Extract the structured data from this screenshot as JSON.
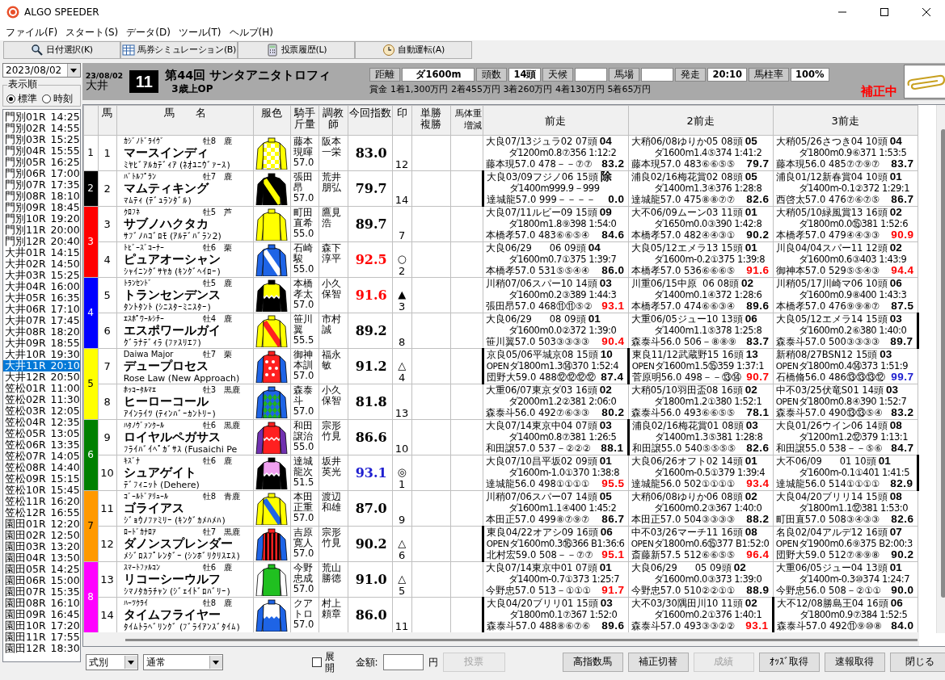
{
  "window": {
    "title": "ALGO SPEEDER"
  },
  "menu": [
    "ファイル(F)",
    "スタート(S)",
    "データ(D)",
    "ツール(T)",
    "ヘルプ(H)"
  ],
  "toolbar": [
    "日付選択(K)",
    "馬券シミュレーション(B)",
    "投票履歴(L)",
    "自動運転(A)"
  ],
  "date_picker": {
    "value": "2023/08/02"
  },
  "sort_order": {
    "label": "表示順",
    "options": [
      {
        "label": "標準",
        "selected": true
      },
      {
        "label": "時刻",
        "selected": false
      }
    ]
  },
  "races": [
    {
      "name": "門別01R",
      "time": "14:25",
      "selected": false
    },
    {
      "name": "門別02R",
      "time": "14:55",
      "selected": false
    },
    {
      "name": "門別03R",
      "time": "15:25",
      "selected": false
    },
    {
      "name": "門別04R",
      "time": "15:55",
      "selected": false
    },
    {
      "name": "門別05R",
      "time": "16:25",
      "selected": false
    },
    {
      "name": "門別06R",
      "time": "17:00",
      "selected": false
    },
    {
      "name": "門別07R",
      "time": "17:35",
      "selected": false
    },
    {
      "name": "門別08R",
      "time": "18:10",
      "selected": false
    },
    {
      "name": "門別09R",
      "time": "18:45",
      "selected": false
    },
    {
      "name": "門別10R",
      "time": "19:20",
      "selected": false
    },
    {
      "name": "門別11R",
      "time": "20:00",
      "selected": false
    },
    {
      "name": "門別12R",
      "time": "20:40",
      "selected": false
    },
    {
      "name": "大井01R",
      "time": "14:15",
      "selected": false
    },
    {
      "name": "大井02R",
      "time": "14:50",
      "selected": false
    },
    {
      "name": "大井03R",
      "time": "15:25",
      "selected": false
    },
    {
      "name": "大井04R",
      "time": "16:00",
      "selected": false
    },
    {
      "name": "大井05R",
      "time": "16:35",
      "selected": false
    },
    {
      "name": "大井06R",
      "time": "17:10",
      "selected": false
    },
    {
      "name": "大井07R",
      "time": "17:45",
      "selected": false
    },
    {
      "name": "大井08R",
      "time": "18:20",
      "selected": false
    },
    {
      "name": "大井09R",
      "time": "18:55",
      "selected": false
    },
    {
      "name": "大井10R",
      "time": "19:30",
      "selected": false
    },
    {
      "name": "大井11R",
      "time": "20:10",
      "selected": true
    },
    {
      "name": "大井12R",
      "time": "20:50",
      "selected": false
    },
    {
      "name": "笠松01R",
      "time": "11:00",
      "selected": false
    },
    {
      "name": "笠松02R",
      "time": "11:30",
      "selected": false
    },
    {
      "name": "笠松03R",
      "time": "12:05",
      "selected": false
    },
    {
      "name": "笠松04R",
      "time": "12:35",
      "selected": false
    },
    {
      "name": "笠松05R",
      "time": "13:05",
      "selected": false
    },
    {
      "name": "笠松06R",
      "time": "13:35",
      "selected": false
    },
    {
      "name": "笠松07R",
      "time": "14:05",
      "selected": false
    },
    {
      "name": "笠松08R",
      "time": "14:40",
      "selected": false
    },
    {
      "name": "笠松09R",
      "time": "15:15",
      "selected": false
    },
    {
      "name": "笠松10R",
      "time": "15:45",
      "selected": false
    },
    {
      "name": "笠松11R",
      "time": "16:20",
      "selected": false
    },
    {
      "name": "笠松12R",
      "time": "16:55",
      "selected": false
    },
    {
      "name": "園田01R",
      "time": "12:20",
      "selected": false
    },
    {
      "name": "園田02R",
      "time": "12:50",
      "selected": false
    },
    {
      "name": "園田03R",
      "time": "13:20",
      "selected": false
    },
    {
      "name": "園田04R",
      "time": "13:50",
      "selected": false
    },
    {
      "name": "園田05R",
      "time": "14:25",
      "selected": false
    },
    {
      "name": "園田06R",
      "time": "15:00",
      "selected": false
    },
    {
      "name": "園田07R",
      "time": "15:35",
      "selected": false
    },
    {
      "name": "園田08R",
      "time": "16:10",
      "selected": false
    },
    {
      "name": "園田09R",
      "time": "16:45",
      "selected": false
    },
    {
      "name": "園田10R",
      "time": "17:20",
      "selected": false
    },
    {
      "name": "園田11R",
      "time": "17:55",
      "selected": false
    },
    {
      "name": "園田12R",
      "time": "18:30",
      "selected": false
    }
  ],
  "race_header": {
    "date": "23/08/02",
    "venue": "大井",
    "number": "11",
    "title": "第44回 サンタアニタトロフィ",
    "class": "3歳上OP",
    "fields": [
      {
        "label": "距離",
        "value": "ダ1600m"
      },
      {
        "label": "頭数",
        "value": "14頭"
      },
      {
        "label": "天候"
      },
      {
        "label": "馬場"
      },
      {
        "label": "発走",
        "value": "20:10"
      },
      {
        "label": "馬柱率",
        "value": "100%"
      }
    ],
    "prize": "賞金 1着1,300万円 2着455万円 3着260万円 4着130万円 5着65万円",
    "status": "補正中"
  },
  "table": {
    "columns": [
      "馬",
      "馬　　名",
      "服色",
      "騎手斤量",
      "調教師",
      "今回指数",
      "印",
      "単勝複勝",
      "馬体重増減",
      "前走",
      "2前走",
      "3前走"
    ],
    "frames": [
      {
        "number": "1",
        "color": "#ffffff",
        "horses": [
          {
            "number": "1",
            "sire": "ｶｼﾞﾉﾄﾞﾗｲｳﾞ",
            "sex_age": "牡8",
            "coat": "鹿",
            "name": "マースインディ",
            "dam": "ﾐﾔﾋﾞｱﾙｶﾃﾞｨｱ (ﾈｵﾕﾆｳﾞｧｰｽ)",
            "jockey": "藤本現暉",
            "weight": "57.0",
            "trainer": "阪本一栄",
            "index": "83.0",
            "color": "#000000",
            "popularity": "12",
            "end_bar": false,
            "races": [
              {
                "line": "大良07/13ジュラ02 07頭",
                "finish": "04",
                "detail": "ダ1200m0.8⑦356 1:12:2",
                "jockey": "藤本現57.0 478－－⑦⑦",
                "index": "83.2",
                "color": "#000000",
                "bar": false
              },
              {
                "line": "大稍06/08ゆりか05 08頭",
                "finish": "05",
                "detail": "ダ1600m1.4⑤374 1:41:2",
                "jockey": "藤本現57.0 483⑥⑥⑤⑤",
                "index": "79.7",
                "color": "#000000",
                "bar": false
              },
              {
                "line": "大稍05/26さつき04 10頭",
                "finish": "04",
                "detail": "ダ1800m0.9⑥371 1:53:5",
                "jockey": "藤本現56.0 485⑦⑦⑨⑦",
                "index": "83.7",
                "color": "#000000",
                "bar": false
              }
            ]
          }
        ]
      },
      {
        "number": "2",
        "color": "#000000",
        "horses": [
          {
            "number": "2",
            "sire": "ﾊﾞﾄﾙﾌﾟﾗﾝ",
            "sex_age": "牡7",
            "coat": "鹿",
            "name": "マムティキング",
            "dam": "ﾏﾑﾃｨ (ﾃﾞｭﾗﾝﾀﾞﾙ)",
            "jockey": "張田昂",
            "weight": "57.0",
            "trainer": "荒井朋弘",
            "index": "79.7",
            "color": "#000000",
            "popularity": "14",
            "end_bar": false,
            "races": [
              {
                "line": "大良03/09フジノ06 15頭",
                "finish": "除",
                "detail": "ダ1400m999.9－999",
                "jockey": "達城龍57.0 999－－－－",
                "index": "0.0",
                "color": "#000000",
                "bar": true
              },
              {
                "line": "浦良02/16梅花賞02 08頭",
                "finish": "05",
                "detail": "ダ1400m1.3④376 1:28:8",
                "jockey": "達城龍57.0 475⑧⑧⑦⑦",
                "index": "82.6",
                "color": "#000000",
                "bar": false
              },
              {
                "line": "浦良01/12新春賞04 10頭",
                "finish": "01",
                "detail": "ダ1400m-0.1②372 1:29:1",
                "jockey": "西啓太57.0 476⑦⑥⑦⑤",
                "index": "86.7",
                "color": "#000000",
                "bar": false
              }
            ]
          }
        ]
      },
      {
        "number": "3",
        "color": "#ff0000",
        "horses": [
          {
            "number": "3",
            "sire": "ｸﾛﾌﾈ",
            "sex_age": "牡5",
            "coat": "芦",
            "name": "サブノハクタカ",
            "dam": "ｻﾌﾞﾉﾊｺﾞﾛﾓ (ｱﾙﾃﾞﾊﾞﾗﾝ2)",
            "jockey": "町田直希",
            "weight": "55.0",
            "trainer": "鷹見浩",
            "index": "89.7",
            "color": "#000000",
            "popularity": "7",
            "end_bar": false,
            "races": [
              {
                "line": "大良07/11ルビー09 15頭",
                "finish": "09",
                "detail": "ダ1800m1.8⑨398 1:54:0",
                "jockey": "本橋孝57.0 483⑥⑥⑤④",
                "index": "84.6",
                "color": "#000000",
                "bar": false
              },
              {
                "line": "大不06/09ムーン03 11頭",
                "finish": "01",
                "detail": "ダ1650m0.0③390 1:42:8",
                "jockey": "本橋孝57.0 482④④③①",
                "index": "90.2",
                "color": "#000000",
                "bar": false
              },
              {
                "line": "大稍05/10緑風賞13 16頭",
                "finish": "02",
                "detail": "ダ1800m0.0⑮381 1:52:6",
                "jockey": "本橋孝57.0 479④④③③",
                "index": "90.9",
                "color": "#ff0000",
                "bar": false
              }
            ]
          },
          {
            "number": "4",
            "sire": "ﾄﾋﾞｰｽﾞｺｰﾅｰ",
            "sex_age": "牡6",
            "coat": "栗",
            "name": "ピュアオーシャン",
            "dam": "ｼｬｲﾆﾝｸﾞｻﾔｶ (ｷﾝｸﾞﾍｲﾛｰ)",
            "jockey": "石崎駿",
            "weight": "55.0",
            "trainer": "森下淳平",
            "index": "92.5",
            "color": "#ff0000",
            "mark": "○",
            "popularity": "2",
            "end_bar": false,
            "races": [
              {
                "line": "大良06/29      06 09頭",
                "finish": "04",
                "detail": "ダ1600m0.7①375 1:39:7",
                "jockey": "本橋孝57.0 531⑤⑤④④",
                "index": "86.0",
                "color": "#000000",
                "bar": false
              },
              {
                "line": "大良05/12エメラ13 15頭",
                "finish": "01",
                "detail": "ダ1600m-0.2①375 1:39:8",
                "jockey": "本橋孝57.0 536⑥⑥⑥⑤",
                "index": "91.6",
                "color": "#ff0000",
                "bar": false
              },
              {
                "line": "川良04/04スパー11 12頭",
                "finish": "02",
                "detail": "ダ1600m0.6③403 1:43:9",
                "jockey": "御神本57.0 529⑤⑤④③",
                "index": "94.4",
                "color": "#ff0000",
                "bar": false
              }
            ]
          }
        ]
      },
      {
        "number": "4",
        "color": "#0000ff",
        "horses": [
          {
            "number": "5",
            "sire": "ﾄﾗﾝｾﾝﾄﾞ",
            "sex_age": "牡5",
            "coat": "鹿",
            "name": "トランセンデンス",
            "dam": "ﾀﾝﾄﾀﾝﾄ (ｼﾆｽﾀｰﾐﾆｽﾀｰ)",
            "jockey": "本橋孝太",
            "weight": "57.0",
            "trainer": "小久保智",
            "index": "91.6",
            "color": "#ff0000",
            "mark": "▲",
            "popularity": "3",
            "end_bar": false,
            "races": [
              {
                "line": "川稍07/06スパー10 14頭",
                "finish": "03",
                "detail": "ダ1600m0.2③389 1:44:3",
                "jockey": "張田昂57.0 468⑪⑪⑤②",
                "index": "93.1",
                "color": "#ff0000",
                "bar": false
              },
              {
                "line": "川重06/15中原  06 08頭",
                "finish": "02",
                "detail": "ダ1400m0.1④372 1:28:6",
                "jockey": "本橋孝57.0 474⑥⑥③④",
                "index": "89.6",
                "color": "#000000",
                "bar": false
              },
              {
                "line": "川稍05/17川崎マ06 10頭",
                "finish": "06",
                "detail": "ダ1600m0.9⑧400 1:43:3",
                "jockey": "本橋孝57.0 476⑨⑨⑧⑦",
                "index": "87.5",
                "color": "#000000",
                "bar": false
              }
            ]
          },
          {
            "number": "6",
            "sire": "ｴｽﾎﾟﾜｰﾙｼﾁｰ",
            "sex_age": "牡4",
            "coat": "鹿",
            "name": "エスポワールガイ",
            "dam": "ｸﾞﾗﾅﾃﾞｨﾗ (ﾌｧｽﾘｴﾌ)",
            "jockey": "笹川翼",
            "weight": "55.5",
            "trainer": "市村誠",
            "index": "89.2",
            "color": "#000000",
            "popularity": "8",
            "end_bar": true,
            "races": [
              {
                "line": "大良06/29      08 09頭",
                "finish": "01",
                "detail": "ダ1600m0.0②372 1:39:0",
                "jockey": "笹川翼57.0 503③③③③",
                "index": "90.4",
                "color": "#ff0000",
                "bar": false
              },
              {
                "line": "大重06/05ジュー10 13頭",
                "finish": "06",
                "detail": "ダ1400m1.1⑤378 1:25:8",
                "jockey": "森泰斗56.0 506－⑧⑧⑨",
                "index": "83.7",
                "color": "#000000",
                "bar": false
              },
              {
                "line": "大良05/12エメラ14 15頭",
                "finish": "03",
                "detail": "ダ1600m0.2⑥380 1:40:0",
                "jockey": "森泰斗57.0 500③③③③",
                "index": "89.7",
                "color": "#000000",
                "bar": false
              }
            ]
          }
        ]
      },
      {
        "number": "5",
        "color": "#ffff00",
        "horses": [
          {
            "number": "7",
            "sire": "Daiwa Major",
            "sex_age": "牡7",
            "coat": "栗",
            "name": "デュープロセス",
            "dam": "Rose Law (New Approach)",
            "jockey": "御神本訓",
            "weight": "57.0",
            "trainer": "福永敏",
            "index": "91.2",
            "color": "#000000",
            "mark": "△",
            "popularity": "4",
            "end_bar": false,
            "races": [
              {
                "line": "京良05/06平城京08 15頭",
                "finish": "10",
                "class": "OPEN",
                "detail": "ダ1800m1.3⑭370 1:52:4",
                "jockey": "団野大59.0 488⑫⑫⑫⑫",
                "index": "87.4",
                "color": "#000000",
                "bar": true
              },
              {
                "line": "東良11/12武蔵野15 16頭",
                "finish": "13",
                "class": "OPEN",
                "detail": "ダ1600m1.5⑮359 1:37:1",
                "jockey": "菅原明56.0 498－－⑬⑭",
                "index": "90.7",
                "color": "#ff0000",
                "bar": true
              },
              {
                "line": "新稍08/27BSN12 15頭",
                "finish": "03",
                "class": "OPEN",
                "detail": "ダ1800m0.4⑭373 1:51:9",
                "jockey": "石橋脩56.0 486⑬⑬⑬⑫",
                "index": "99.7",
                "color": "#2020d0",
                "bar": false
              }
            ]
          },
          {
            "number": "8",
            "sire": "ﾎｯｺｰﾀﾙﾏｴ",
            "sex_age": "牡3",
            "coat": "黒鹿",
            "name": "ヒーローコール",
            "dam": "ｱｲﾝﾗｲﾂ (ﾃｨﾝﾊﾞｰｶﾝﾄﾘｰ)",
            "jockey": "森泰斗",
            "weight": "57.0",
            "trainer": "小久保智",
            "index": "81.8",
            "color": "#000000",
            "popularity": "13",
            "end_bar": false,
            "races": [
              {
                "line": "大重06/07東京ダ03 16頭",
                "finish": "02",
                "detail": "ダ2000m1.2②381 2:06:0",
                "jockey": "森泰斗56.0 492⑦⑥③③",
                "index": "80.2",
                "color": "#000000",
                "bar": false
              },
              {
                "line": "大稍05/10羽田盃08 16頭",
                "finish": "02",
                "detail": "ダ1800m1.2①380 1:52:1",
                "jockey": "森泰斗56.0 493⑥⑥⑤⑤",
                "index": "78.1",
                "color": "#000000",
                "bar": false
              },
              {
                "line": "中不03/25伏竜S01 14頭",
                "finish": "03",
                "class": "OPEN",
                "detail": "ダ1800m0.8④390 1:52:7",
                "jockey": "森泰斗57.0 490⑬⑬⑤④",
                "index": "83.2",
                "color": "#000000",
                "bar": false
              }
            ]
          }
        ]
      },
      {
        "number": "6",
        "color": "#008000",
        "horses": [
          {
            "number": "9",
            "sire": "ﾊﾀﾉｳﾞｧﾝｸｰﾙ",
            "sex_age": "牡6",
            "coat": "黒鹿",
            "name": "ロイヤルペガサス",
            "dam": "ﾌﾗｲﾊﾞｲﾍﾟｶﾞｻｽ (Fusaichi Pe",
            "jockey": "和田譲治",
            "weight": "55.0",
            "trainer": "宗形竹見",
            "index": "86.6",
            "color": "#000000",
            "popularity": "10",
            "end_bar": false,
            "races": [
              {
                "line": "大良07/14東京中04 07頭",
                "finish": "03",
                "detail": "ダ1400m0.8⑦381 1:26:5",
                "jockey": "和田譲57.0 537－②②②",
                "index": "88.1",
                "color": "#000000",
                "bar": false
              },
              {
                "line": "浦良02/16梅花賞01 08頭",
                "finish": "03",
                "detail": "ダ1400m1.3⑤381 1:28:8",
                "jockey": "和田譲55.0 540⑤⑤⑤⑤",
                "index": "82.6",
                "color": "#000000",
                "bar": true
              },
              {
                "line": "大良01/26ウイン06 14頭",
                "finish": "08",
                "detail": "ダ1200m1.2⑫379 1:13:1",
                "jockey": "和田譲55.0 538－－⑤⑥",
                "index": "84.7",
                "color": "#000000",
                "bar": false
              }
            ]
          },
          {
            "number": "10",
            "sire": "ｷｽﾞﾅ",
            "sex_age": "牡6",
            "coat": "鹿",
            "name": "シュアゲイト",
            "dam": "ﾃﾞﾌｨﾆｯﾄ (Dehere)",
            "jockey": "達城龍次",
            "weight": "51.5",
            "trainer": "坂井英光",
            "index": "93.1",
            "color": "#2020d0",
            "mark": "◎",
            "popularity": "1",
            "end_bar": true,
            "races": [
              {
                "line": "大良07/10昌平坂02 09頭",
                "finish": "01",
                "detail": "ダ1600m-1.0①370 1:38:8",
                "jockey": "達城龍56.0 498①①①①",
                "index": "95.5",
                "color": "#ff0000",
                "bar": false
              },
              {
                "line": "大良06/26オフト02 14頭",
                "finish": "01",
                "detail": "ダ1600m-0.5①379 1:39:4",
                "jockey": "達城龍56.0 502①①①①",
                "index": "93.4",
                "color": "#ff0000",
                "bar": false
              },
              {
                "line": "大不06/09      01 10頭",
                "finish": "01",
                "detail": "ダ1600m-0.1①401 1:41:5",
                "jockey": "達城龍56.0 514①①①①",
                "index": "82.9",
                "color": "#000000",
                "bar": false
              }
            ]
          }
        ]
      },
      {
        "number": "7",
        "color": "#ff9900",
        "horses": [
          {
            "number": "11",
            "sire": "ｺﾞｰﾙﾄﾞｱﾘｭｰﾙ",
            "sex_age": "牡8",
            "coat": "青鹿",
            "name": "ゴライアス",
            "dam": "ｼﾞｮｳﾉﾌｧﾐﾘｰ (ｷﾝｸﾞｶﾒﾊﾒﾊ)",
            "jockey": "本田正重",
            "weight": "57.0",
            "trainer": "渡辺和雄",
            "index": "87.0",
            "color": "#000000",
            "popularity": "9",
            "end_bar": false,
            "races": [
              {
                "line": "川稍07/06スパー07 14頭",
                "finish": "05",
                "detail": "ダ1600m1.1④400 1:45:2",
                "jockey": "本田正57.0 499⑧⑦⑨⑦",
                "index": "86.7",
                "color": "#000000",
                "bar": false
              },
              {
                "line": "大稍06/08ゆりか06 08頭",
                "finish": "02",
                "detail": "ダ1600m0.2③367 1:40:0",
                "jockey": "本田正57.0 504③③③③",
                "index": "88.2",
                "color": "#000000",
                "bar": false
              },
              {
                "line": "大良04/20ブリリ14 15頭",
                "finish": "08",
                "detail": "ダ1800m1.1⑫381 1:53:0",
                "jockey": "町田直57.0 508③④③③",
                "index": "82.6",
                "color": "#000000",
                "bar": false
              }
            ]
          },
          {
            "number": "12",
            "sire": "ﾛｰﾄﾞｶﾅﾛｱ",
            "sex_age": "牡7",
            "coat": "黒鹿",
            "name": "ダノンスプレンダー",
            "dam": "ﾒｼﾞﾛｽﾌﾟﾚﾝﾀﾞｰ (ｼﾝﾎﾞﾘｸﾘｽｴｽ)",
            "jockey": "吉原寛人",
            "weight": "57.0",
            "trainer": "宗形竹見",
            "index": "90.2",
            "color": "#000000",
            "mark": "△",
            "popularity": "6",
            "end_bar": false,
            "races": [
              {
                "line": "東良04/22オアシ09 16頭",
                "finish": "06",
                "class": "OPEN",
                "detail": "ダ1600m0.3⑯366 B1:36:6",
                "jockey": "北村宏59.0 508－－⑦⑦",
                "index": "95.1",
                "color": "#ff0000",
                "bar": true
              },
              {
                "line": "中不03/26マーチ11 16頭",
                "finish": "08",
                "class": "OPEN",
                "detail": "ダ1800m0.6⑮377 B1:52:0",
                "jockey": "斎藤新57.5 512⑥⑥⑤⑤",
                "index": "96.4",
                "color": "#ff0000",
                "bar": false
              },
              {
                "line": "名良02/04アルデ12 16頭",
                "finish": "07",
                "class": "OPEN",
                "detail": "ダ1900m0.6⑨375 B2:00:3",
                "jockey": "団野大59.0 512⑦⑧⑨⑧",
                "index": "90.2",
                "color": "#000000",
                "bar": false
              }
            ]
          }
        ]
      },
      {
        "number": "8",
        "color": "#ff00ff",
        "horses": [
          {
            "number": "13",
            "sire": "ｽﾏｰﾄﾌｧﾙｺﾝ",
            "sex_age": "牡6",
            "coat": "鹿",
            "name": "リコーシーウルフ",
            "dam": "ｼﾏﾉﾀｶﾗﾁｬﾝ (ｼﾞｪｲﾄﾞﾛﾊﾞﾘｰ)",
            "jockey": "今野忠成",
            "weight": "57.0",
            "trainer": "荒山勝徳",
            "index": "91.0",
            "color": "#000000",
            "mark": "△",
            "popularity": "5",
            "end_bar": false,
            "races": [
              {
                "line": "大良07/14東京中01 07頭",
                "finish": "01",
                "detail": "ダ1400m-0.7①373 1:25:7",
                "jockey": "今野忠57.0 513－①①①",
                "index": "91.7",
                "color": "#ff0000",
                "bar": false
              },
              {
                "line": "大良06/29      05 09頭",
                "finish": "02",
                "detail": "ダ1600m0.0③373 1:39:0",
                "jockey": "今野忠57.0 510②②①①",
                "index": "88.9",
                "color": "#000000",
                "bar": false
              },
              {
                "line": "大重06/05ジュー04 13頭",
                "finish": "01",
                "detail": "ダ1400m-0.3⑩374 1:24:7",
                "jockey": "今野忠56.0 508－②①①",
                "index": "90.0",
                "color": "#000000",
                "bar": false
              }
            ]
          },
          {
            "number": "14",
            "sire": "ﾊｰﾂｸﾗｲ",
            "sex_age": "牡8",
            "coat": "鹿",
            "name": "タイムフライヤー",
            "dam": "ﾀｲﾑﾄﾗﾍﾞﾘﾝｸﾞ (ﾌﾞﾗｲｱﾝｽﾞﾀｲﾑ)",
            "jockey": "クアトロ",
            "weight": "57.0",
            "trainer": "村上頼章",
            "index": "86.0",
            "color": "#000000",
            "popularity": "11",
            "end_bar": false,
            "races": [
              {
                "line": "大良04/20ブリリ01 15頭",
                "finish": "03",
                "detail": "ダ1800m0.1⑦367 1:52:0",
                "jockey": "森泰斗57.0 488⑧⑥⑦⑥",
                "index": "89.6",
                "color": "#000000",
                "bar": true
              },
              {
                "line": "大不03/30隅田川10 11頭",
                "finish": "02",
                "detail": "ダ1600m0.2①376 1:40:1",
                "jockey": "森泰斗57.0 493③③②②",
                "index": "93.1",
                "color": "#ff0000",
                "bar": false
              },
              {
                "line": "大不12/08勝島王04 16頭",
                "finish": "06",
                "detail": "ダ1800m0.9⑦384 1:52:5",
                "jockey": "森泰斗57.0 492⑪⑨⑩⑧",
                "index": "84.0",
                "color": "#000000",
                "bar": true
              }
            ]
          }
        ]
      }
    ]
  },
  "bottom": {
    "bet_type": "式別",
    "mode": "通常",
    "expand": {
      "label": "展開",
      "checked": false
    },
    "amount_label": "金額:",
    "unit": "円",
    "vote": {
      "label": "投票",
      "disabled": true
    },
    "buttons": [
      {
        "label": "高指数馬",
        "disabled": false
      },
      {
        "label": "補正切替",
        "disabled": false
      },
      {
        "label": "成績",
        "disabled": true
      },
      {
        "label": "ｵｯｽﾞ取得",
        "disabled": false
      },
      {
        "label": "速報取得",
        "disabled": false
      },
      {
        "label": "閉じる",
        "disabled": false
      }
    ]
  }
}
